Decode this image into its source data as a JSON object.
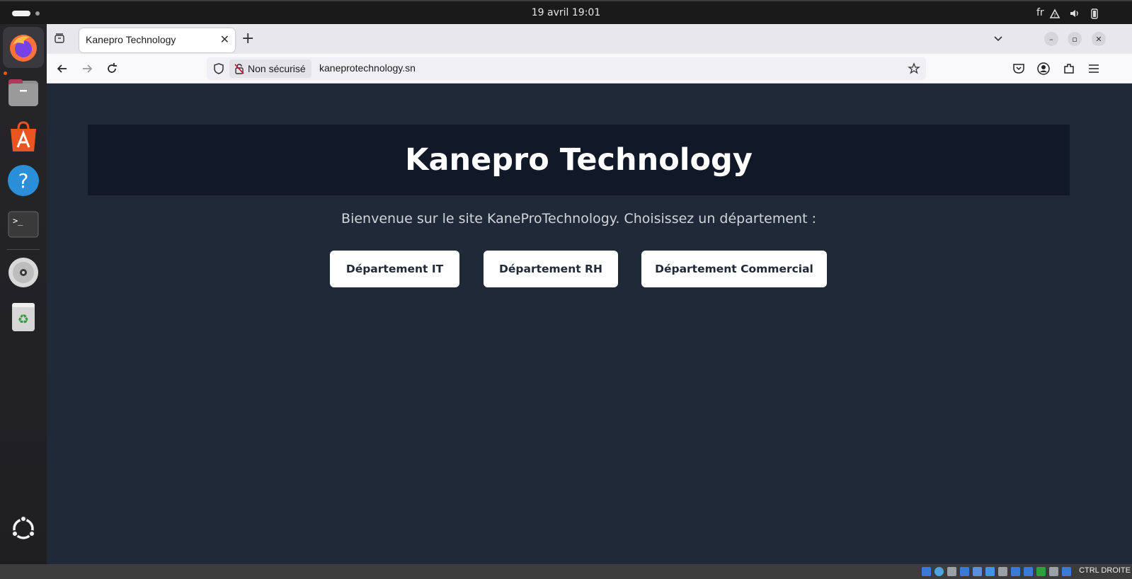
{
  "system": {
    "clock": "19 avril  19:01",
    "language": "fr"
  },
  "dock": {
    "items": [
      {
        "name": "firefox-icon",
        "label": "Firefox"
      },
      {
        "name": "files-icon",
        "label": "Files"
      },
      {
        "name": "app-center-icon",
        "label": "App Center"
      },
      {
        "name": "help-icon",
        "label": "Help"
      },
      {
        "name": "terminal-icon",
        "label": "Terminal"
      },
      {
        "name": "disc-icon",
        "label": "Disc"
      },
      {
        "name": "trash-icon",
        "label": "Trash"
      },
      {
        "name": "ubuntu-apps-icon",
        "label": "Show Apps"
      }
    ]
  },
  "browser": {
    "tab_title": "Kanepro Technology",
    "security_label": "Non sécurisé",
    "url": "kaneprotechnology.sn"
  },
  "page": {
    "title": "Kanepro Technology",
    "intro": "Bienvenue sur le site KaneProTechnology. Choisissez un département :",
    "buttons": [
      "Département IT",
      "Département RH",
      "Département Commercial"
    ]
  },
  "statusbar": {
    "hostkey": "CTRL DROITE"
  },
  "colors": {
    "page_bg": "#1f2937",
    "hero_bg": "#111827",
    "button_bg": "#ffffff",
    "accent": "#e95420"
  }
}
